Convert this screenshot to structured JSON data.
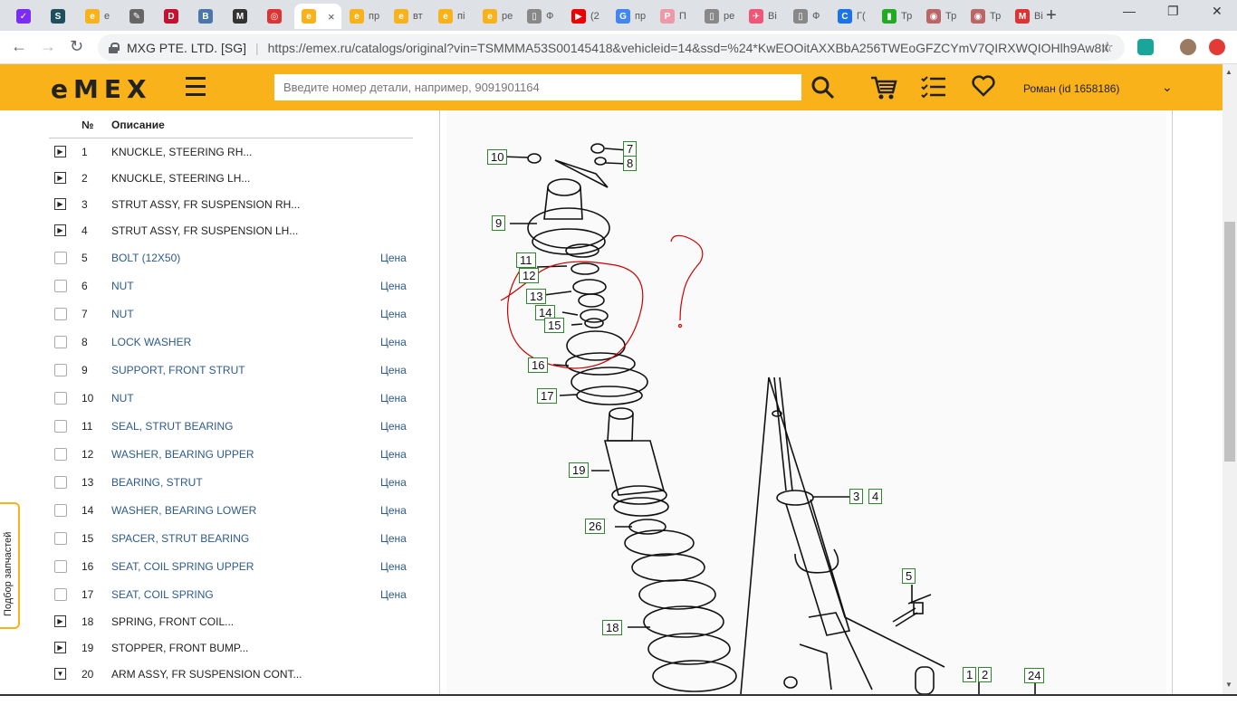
{
  "browser": {
    "tabs": [
      {
        "label": "",
        "color": "#7b2cf5",
        "glyph": "✓"
      },
      {
        "label": "",
        "color": "#1f4e5f",
        "glyph": "S"
      },
      {
        "label": "e",
        "color": "#f9b21a",
        "glyph": "e"
      },
      {
        "label": "",
        "color": "#666",
        "glyph": "✎"
      },
      {
        "label": "",
        "color": "#c8102e",
        "glyph": "D"
      },
      {
        "label": "",
        "color": "#4a76a8",
        "glyph": "В"
      },
      {
        "label": "",
        "color": "#333",
        "glyph": "M"
      },
      {
        "label": "",
        "color": "#d33",
        "glyph": "◎"
      },
      {
        "label": "",
        "color": "#f9b21a",
        "glyph": "e",
        "active": true
      },
      {
        "label": "пр",
        "color": "#f9b21a",
        "glyph": "e"
      },
      {
        "label": "вт",
        "color": "#f9b21a",
        "glyph": "e"
      },
      {
        "label": "пі",
        "color": "#f9b21a",
        "glyph": "e"
      },
      {
        "label": "ре",
        "color": "#f9b21a",
        "glyph": "e"
      },
      {
        "label": "Ф",
        "color": "#888",
        "glyph": "▯"
      },
      {
        "label": "(2",
        "color": "#e00",
        "glyph": "▶"
      },
      {
        "label": "пр",
        "color": "#4285f4",
        "glyph": "G"
      },
      {
        "label": "П",
        "color": "#e9a",
        "glyph": "P"
      },
      {
        "label": "ре",
        "color": "#888",
        "glyph": "▯"
      },
      {
        "label": "Ві",
        "color": "#e57",
        "glyph": "✈"
      },
      {
        "label": "Ф",
        "color": "#888",
        "glyph": "▯"
      },
      {
        "label": "Г(",
        "color": "#1a73e8",
        "glyph": "C"
      },
      {
        "label": "Тр",
        "color": "#2a2",
        "glyph": "▮"
      },
      {
        "label": "Тр",
        "color": "#b66",
        "glyph": "◉"
      },
      {
        "label": "Тр",
        "color": "#b66",
        "glyph": "◉"
      },
      {
        "label": "Ві",
        "color": "#d33",
        "glyph": "M"
      }
    ],
    "active_close": "×",
    "new_tab": "+",
    "window_controls": {
      "minimize": "—",
      "maximize": "❐",
      "close": "✕"
    },
    "nav": {
      "back": "←",
      "forward": "→",
      "reload": "↻"
    },
    "address": {
      "org": "MXG PTE. LTD. [SG]",
      "url": "https://emex.ru/catalogs/original?vin=TSMMMA53S00145418&vehicleid=14&ssd=%24*KwEOOitAXXBbA256TWEoGFZCYmV7QIRXWQIOHlh9Aw8IC..."
    },
    "extensions": [
      {
        "name": "ext-teal",
        "color": "#1aa59a"
      },
      {
        "name": "profile-avatar",
        "color": "#9a7b62"
      },
      {
        "name": "ext-red",
        "color": "#e53935"
      }
    ]
  },
  "site": {
    "logo": "eMEX",
    "search_placeholder": "Введите номер детали, например, 9091901164",
    "user": "Роман  (id 1658186)",
    "icons": {
      "search": "search-icon",
      "cart": "cart-icon",
      "list": "list-icon",
      "favorites": "heart-icon"
    }
  },
  "parts_table": {
    "headers": {
      "num": "№",
      "desc": "Описание"
    },
    "price_label": "Цена",
    "rows": [
      {
        "num": "1",
        "desc": "KNUCKLE, STEERING RH...",
        "type": "expand"
      },
      {
        "num": "2",
        "desc": "KNUCKLE, STEERING LH...",
        "type": "expand"
      },
      {
        "num": "3",
        "desc": "STRUT ASSY, FR SUSPENSION RH...",
        "type": "expand"
      },
      {
        "num": "4",
        "desc": "STRUT ASSY, FR SUSPENSION LH...",
        "type": "expand"
      },
      {
        "num": "5",
        "desc": "BOLT (12X50)",
        "type": "check"
      },
      {
        "num": "6",
        "desc": "NUT",
        "type": "check"
      },
      {
        "num": "7",
        "desc": "NUT",
        "type": "check"
      },
      {
        "num": "8",
        "desc": "LOCK WASHER",
        "type": "check"
      },
      {
        "num": "9",
        "desc": "SUPPORT, FRONT STRUT",
        "type": "check"
      },
      {
        "num": "10",
        "desc": "NUT",
        "type": "check"
      },
      {
        "num": "11",
        "desc": "SEAL, STRUT BEARING",
        "type": "check"
      },
      {
        "num": "12",
        "desc": "WASHER, BEARING UPPER",
        "type": "check"
      },
      {
        "num": "13",
        "desc": "BEARING, STRUT",
        "type": "check"
      },
      {
        "num": "14",
        "desc": "WASHER, BEARING LOWER",
        "type": "check"
      },
      {
        "num": "15",
        "desc": "SPACER, STRUT BEARING",
        "type": "check"
      },
      {
        "num": "16",
        "desc": "SEAT, COIL SPRING UPPER",
        "type": "check"
      },
      {
        "num": "17",
        "desc": "SEAT, COIL SPRING",
        "type": "check"
      },
      {
        "num": "18",
        "desc": "SPRING, FRONT COIL...",
        "type": "expand"
      },
      {
        "num": "19",
        "desc": "STOPPER, FRONT BUMP...",
        "type": "expand"
      },
      {
        "num": "20",
        "desc": "ARM ASSY, FR SUSPENSION CONT...",
        "type": "collapse"
      }
    ]
  },
  "side_tab": "Подбор запчастей",
  "diagram": {
    "callouts": [
      "10",
      "7",
      "8",
      "9",
      "11",
      "12",
      "13",
      "14",
      "15",
      "16",
      "17",
      "19",
      "26",
      "3",
      "4",
      "5",
      "18",
      "1",
      "2",
      "24"
    ],
    "annotation": "?"
  },
  "colors": {
    "brand": "#f9b21a",
    "link": "#2d5b8a",
    "callout_border": "#2a8a2a",
    "annotation": "#cc0000"
  }
}
